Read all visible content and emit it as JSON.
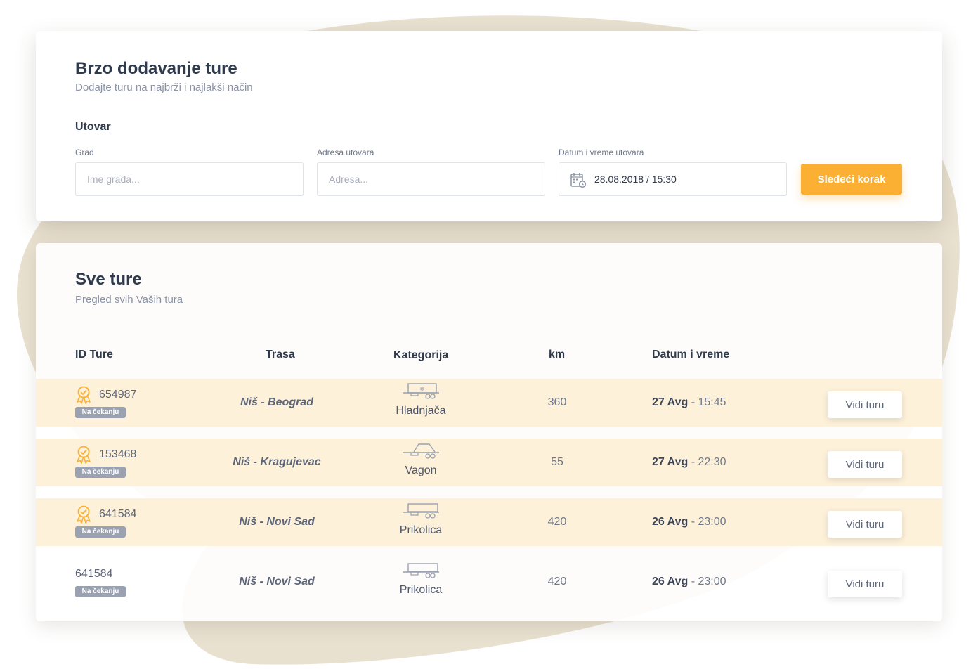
{
  "colors": {
    "accent": "#fbb034",
    "highlight_row": "#fdf1da",
    "blob": "#e9e1d0",
    "status_badge": "#9aa1b0"
  },
  "quick_add": {
    "title": "Brzo dodavanje ture",
    "subtitle": "Dodajte turu na najbrži i najlakši način",
    "section": "Utovar",
    "city_label": "Grad",
    "city_placeholder": "Ime grada...",
    "address_label": "Adresa utovara",
    "address_placeholder": "Adresa...",
    "datetime_label": "Datum i vreme utovara",
    "datetime_value": "28.08.2018 / 15:30",
    "next_button": "Sledeći korak"
  },
  "tours": {
    "title": "Sve ture",
    "subtitle": "Pregled svih Vaših tura",
    "columns": {
      "id": "ID Ture",
      "route": "Trasa",
      "category": "Kategorija",
      "km": "km",
      "datetime": "Datum i vreme"
    },
    "rows": [
      {
        "id": "654987",
        "status": "Na čekanju",
        "route": "Niš - Beograd",
        "category": "Hladnjača",
        "vehicle_icon": "refrigerated-truck-icon",
        "km": "360",
        "date": "27 Avg",
        "time": "- 15:45",
        "action": "Vidi turu",
        "highlighted": true,
        "award_icon": true
      },
      {
        "id": "153468",
        "status": "Na čekanju",
        "route": "Niš - Kragujevac",
        "category": "Vagon",
        "vehicle_icon": "wagon-icon",
        "km": "55",
        "date": "27 Avg",
        "time": "- 22:30",
        "action": "Vidi turu",
        "highlighted": true,
        "award_icon": true
      },
      {
        "id": "641584",
        "status": "Na čekanju",
        "route": "Niš - Novi Sad",
        "category": "Prikolica",
        "vehicle_icon": "trailer-icon",
        "km": "420",
        "date": "26 Avg",
        "time": "- 23:00",
        "action": "Vidi turu",
        "highlighted": true,
        "award_icon": true
      },
      {
        "id": "641584",
        "status": "Na čekanju",
        "route": "Niš - Novi Sad",
        "category": "Prikolica",
        "vehicle_icon": "trailer-icon",
        "km": "420",
        "date": "26 Avg",
        "time": "- 23:00",
        "action": "Vidi turu",
        "highlighted": false,
        "award_icon": false
      }
    ]
  }
}
